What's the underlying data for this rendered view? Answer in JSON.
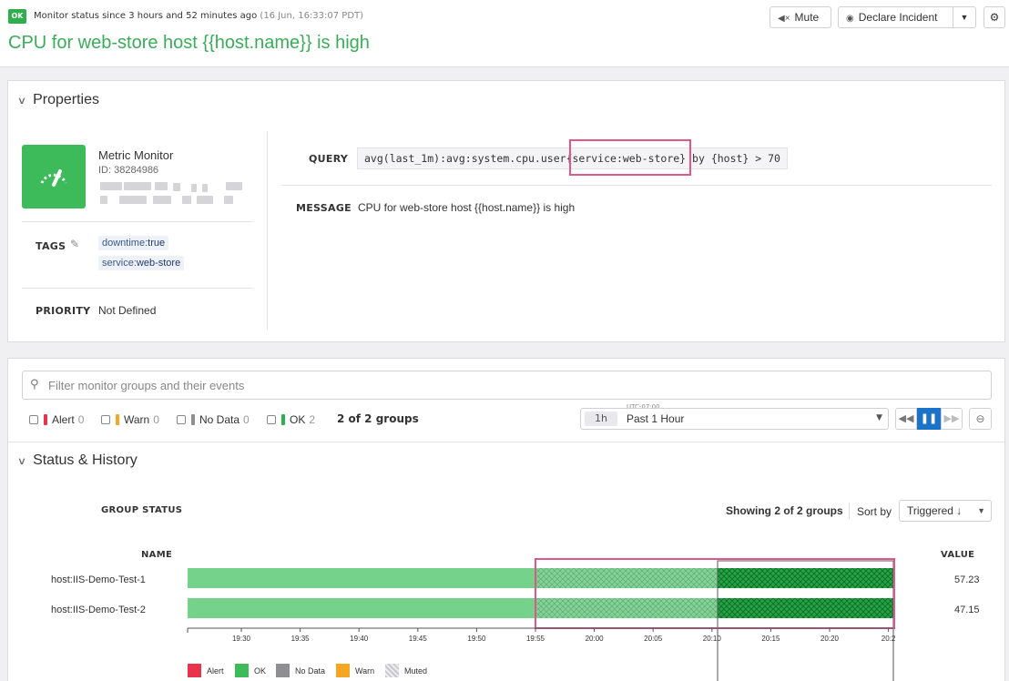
{
  "header": {
    "status_badge": "OK",
    "status_text": "Monitor status since 3 hours and 52 minutes ago",
    "status_time": "(16 Jun, 16:33:07 PDT)",
    "title": "CPU for web-store host {{host.name}} is high",
    "mute_label": "Mute",
    "declare_label": "Declare Incident"
  },
  "properties": {
    "heading": "Properties",
    "monitor_type": "Metric Monitor",
    "monitor_id": "ID: 38284986",
    "tags_label": "TAGS",
    "tags": [
      {
        "key": "downtime:",
        "value": "true"
      },
      {
        "key": "service:",
        "value": "web-store"
      }
    ],
    "priority_label": "PRIORITY",
    "priority_value": "Not Defined",
    "query_label": "QUERY",
    "query_prefix": "avg(last_1m):avg:system.cpu.user",
    "query_highlight": "{service:web-store}",
    "query_suffix": " by {host} > 70",
    "message_label": "MESSAGE",
    "message_value": "CPU for web-store host {{host.name}} is high"
  },
  "filter": {
    "placeholder": "Filter monitor groups and their events",
    "checks": [
      {
        "label": "Alert",
        "count": "0",
        "color": "#e8334a"
      },
      {
        "label": "Warn",
        "count": "0",
        "color": "#f5a623"
      },
      {
        "label": "No Data",
        "count": "0",
        "color": "#8e8e93"
      },
      {
        "label": "OK",
        "count": "2",
        "color": "#2fae4d"
      }
    ],
    "groups_count": "2 of 2 groups",
    "timezone": "UTC-07:00",
    "time_chip": "1h",
    "time_range": "Past 1 Hour"
  },
  "status_history": {
    "heading": "Status & History",
    "group_status_label": "GROUP STATUS",
    "showing": "Showing 2 of 2 groups",
    "sort_label": "Sort by",
    "sort_value": "Triggered ↓",
    "name_header": "NAME",
    "value_header": "VALUE",
    "rows": [
      {
        "name": "host:IIS-Demo-Test-1",
        "value": "57.23"
      },
      {
        "name": "host:IIS-Demo-Test-2",
        "value": "47.15"
      }
    ],
    "timeline": {
      "ticks": [
        "19:30",
        "19:35",
        "19:40",
        "19:45",
        "19:50",
        "19:55",
        "20:00",
        "20:05",
        "20:10",
        "20:15",
        "20:20",
        "20:2"
      ],
      "status": "OK",
      "muted_from": "19:55",
      "cursor_at": "20:10"
    },
    "legend": [
      {
        "label": "Alert",
        "color": "#e8334a"
      },
      {
        "label": "OK",
        "color": "#3dbb5a"
      },
      {
        "label": "No Data",
        "color": "#8e8e93"
      },
      {
        "label": "Warn",
        "color": "#f5a623"
      },
      {
        "label": "Muted",
        "color": "#d0d0d4"
      }
    ]
  }
}
